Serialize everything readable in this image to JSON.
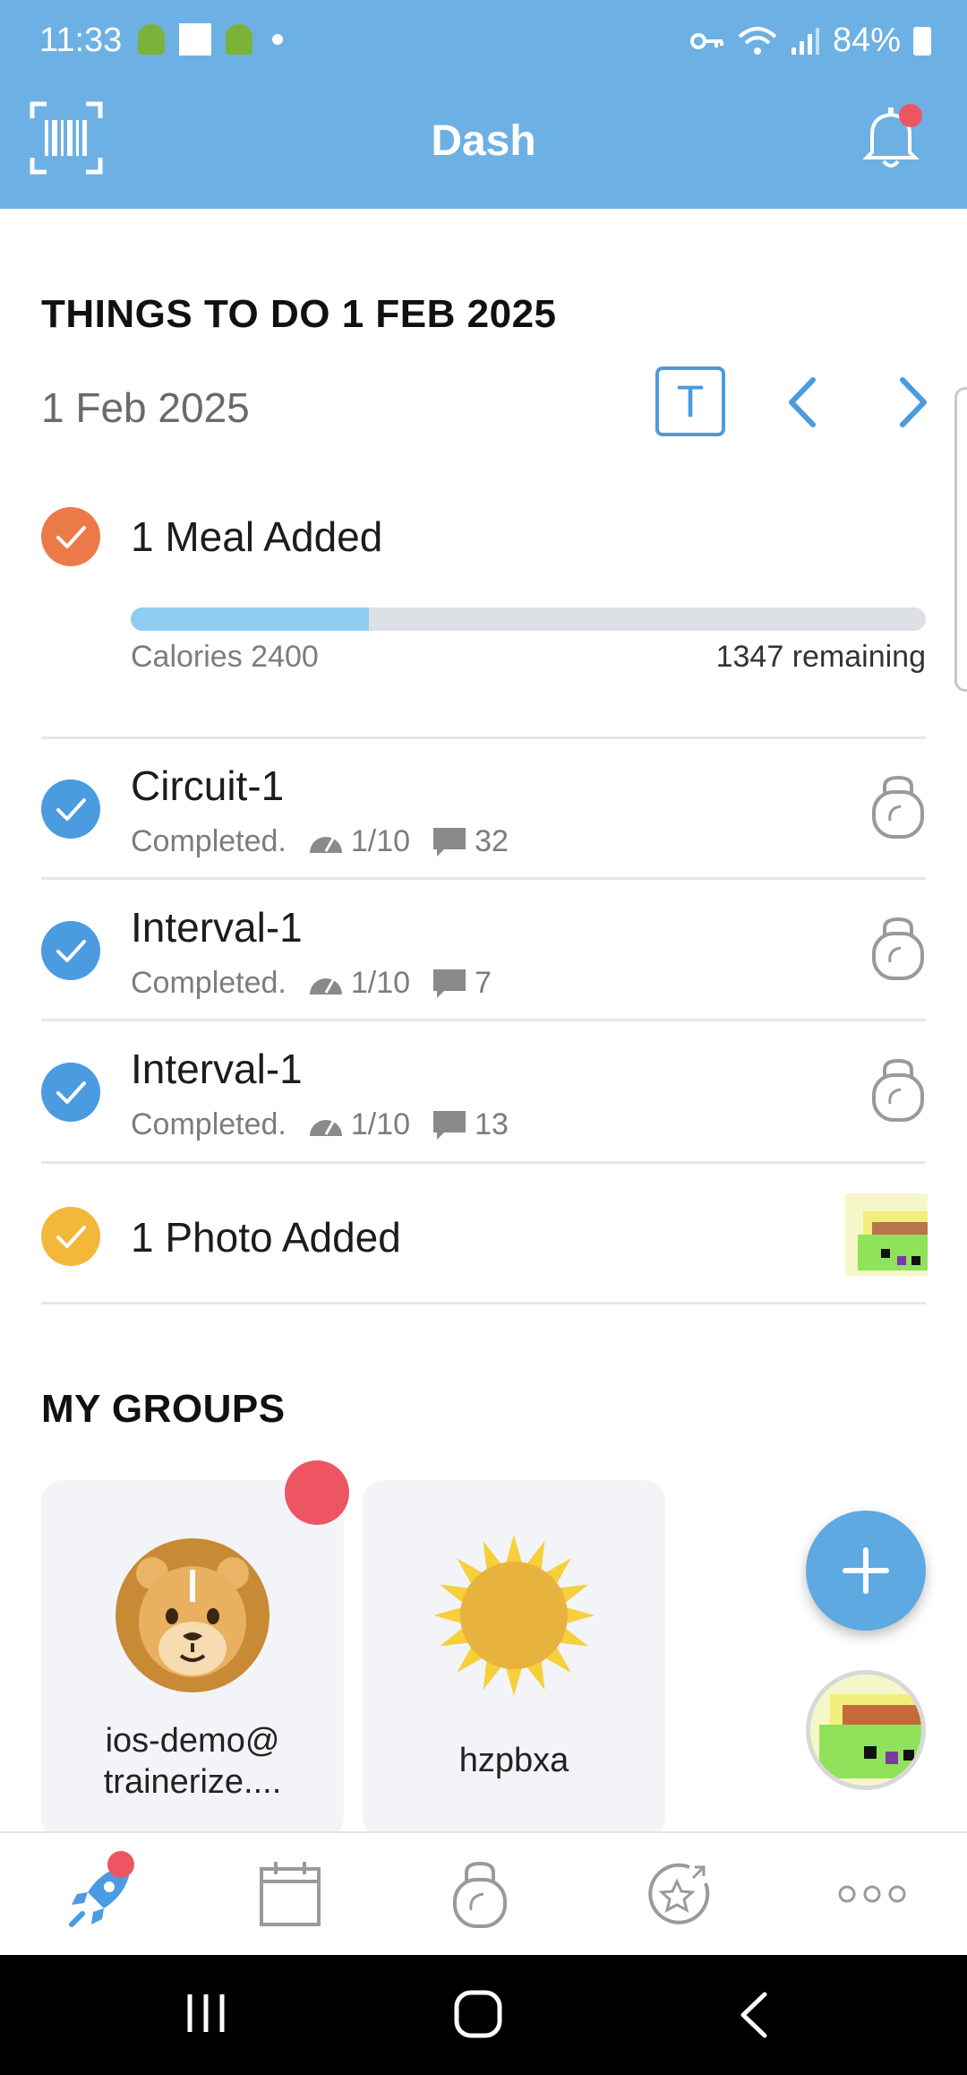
{
  "status_bar": {
    "time": "11:33",
    "battery": "84%"
  },
  "header": {
    "title": "Dash",
    "has_notification": true
  },
  "todo": {
    "section_title": "THINGS TO DO 1 FEB 2025",
    "date": "1 Feb 2025",
    "today_button": "T",
    "meal": {
      "label": "1 Meal Added",
      "calories_label": "Calories 2400",
      "remaining_label": "1347 remaining",
      "progress_fraction": 0.3
    },
    "workouts": [
      {
        "title": "Circuit-1",
        "status": "Completed.",
        "rating": "1/10",
        "comments": "32"
      },
      {
        "title": "Interval-1",
        "status": "Completed.",
        "rating": "1/10",
        "comments": "7"
      },
      {
        "title": "Interval-1",
        "status": "Completed.",
        "rating": "1/10",
        "comments": "13"
      }
    ],
    "photo": {
      "label": "1 Photo Added"
    }
  },
  "groups": {
    "section_title": "MY GROUPS",
    "items": [
      {
        "name_line1": "ios-demo@",
        "name_line2": "trainerize....",
        "icon": "lion-icon",
        "unread": true
      },
      {
        "name_line1": "hzpbxa",
        "name_line2": "",
        "icon": "sun-icon",
        "unread": false
      }
    ]
  },
  "bottom_nav": {
    "tabs": [
      "rocket-icon",
      "calendar-icon",
      "kettlebell-icon",
      "star-badge-icon",
      "more-icon"
    ],
    "active": "rocket-icon"
  },
  "colors": {
    "header_bg": "#6db0e4",
    "accent_blue": "#4a9be0",
    "meal_orange": "#ec7a48",
    "photo_yellow": "#f3b73a",
    "badge_red": "#ee5563"
  }
}
